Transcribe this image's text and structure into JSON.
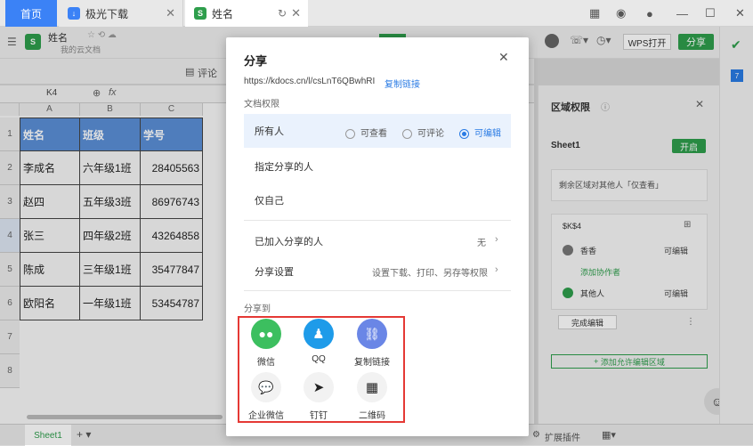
{
  "tabs": {
    "home": "首页",
    "download": "极光下载",
    "doc": "姓名"
  },
  "doc": {
    "title": "姓名",
    "location": "我的云文档"
  },
  "appbar": {
    "wps_open": "WPS打开",
    "share": "分享"
  },
  "toolbar": {
    "comment": "评论"
  },
  "formula": {
    "cell_ref": "K4",
    "fx": "fx"
  },
  "sheet": {
    "columns": [
      "A",
      "B",
      "C"
    ],
    "rows": [
      "1",
      "2",
      "3",
      "4",
      "5",
      "6",
      "7",
      "8"
    ],
    "header": [
      "姓名",
      "班级",
      "学号"
    ],
    "data": [
      [
        "李成名",
        "六年级1班",
        "28405563"
      ],
      [
        "赵四",
        "五年级3班",
        "86976743"
      ],
      [
        "张三",
        "四年级2班",
        "43264858"
      ],
      [
        "陈成",
        "三年级1班",
        "35477847"
      ],
      [
        "欧阳名",
        "一年级1班",
        "53454787"
      ]
    ],
    "tab": "Sheet1",
    "extensions": "扩展插件"
  },
  "dialog": {
    "title": "分享",
    "link": "https://kdocs.cn/l/csLnT6QBwhRI",
    "copy_link": "复制链接",
    "perm_title": "文档权限",
    "everyone": "所有人",
    "view": "可查看",
    "comment": "可评论",
    "edit": "可编辑",
    "specified": "指定分享的人",
    "only_me": "仅自己",
    "joined": "已加入分享的人",
    "joined_value": "无",
    "settings": "分享设置",
    "settings_value": "设置下载、打印、另存等权限",
    "share_to": "分享到",
    "targets": [
      "微信",
      "QQ",
      "复制链接",
      "企业微信",
      "钉钉",
      "二维码"
    ]
  },
  "panel": {
    "title": "区域权限",
    "sheet": "Sheet1",
    "open": "开启",
    "desc": "剩余区域对其他人「仅查看」",
    "range": "$K$4",
    "user1": "香香",
    "user1_perm": "可编辑",
    "add_collab": "添加协作者",
    "user2": "其他人",
    "user2_perm": "可编辑",
    "done": "完成编辑",
    "add_area": "添加允许编辑区域"
  },
  "colors": {
    "accent": "#2a7be4",
    "brand_green": "#2e9e4c",
    "header_blue": "#5b8fd6",
    "highlight_red": "#e53935"
  }
}
